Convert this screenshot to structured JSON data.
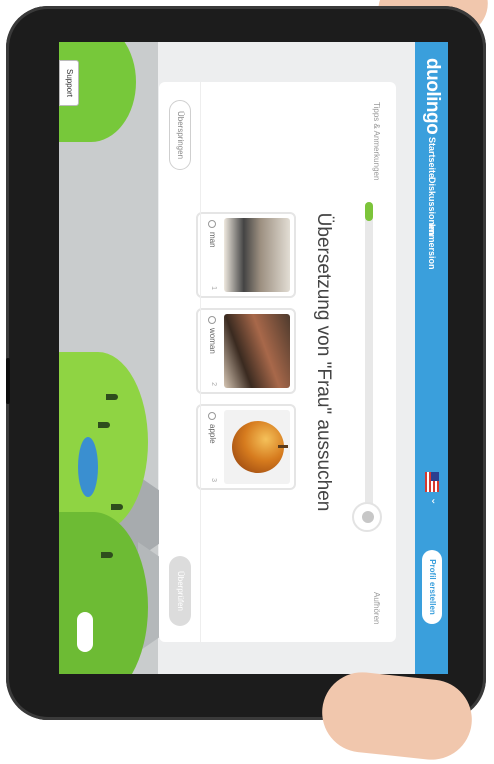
{
  "app": {
    "logo": "duolingo",
    "nav": {
      "home": "Startseite",
      "discussions": "Diskussionen",
      "immersion": "Immersion"
    },
    "language_flag": "us-flag-icon",
    "profile_button": "Profil erstellen"
  },
  "lesson": {
    "tips_link": "Tipps & Anmerkungen",
    "progress": 0.06,
    "quit_link": "Aufhören",
    "prompt": "Übersetzung von \"Frau\" aussuchen",
    "choices": [
      {
        "label": "man",
        "number": "1"
      },
      {
        "label": "woman",
        "number": "2"
      },
      {
        "label": "apple",
        "number": "3"
      }
    ],
    "skip_button": "Überspringen",
    "check_button": "Überprüfen"
  },
  "support_tab": "Support",
  "colors": {
    "topbar": "#3a9fdc",
    "accent_green": "#7cc43a",
    "check_disabled": "#dcdcdc"
  }
}
